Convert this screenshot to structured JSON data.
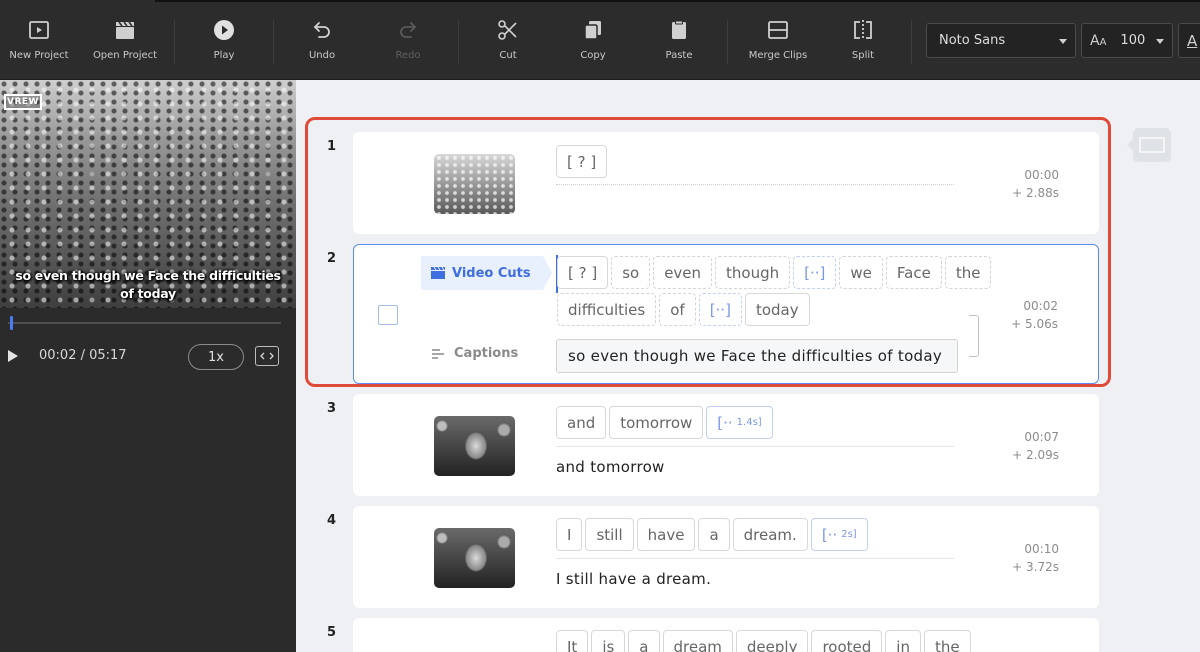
{
  "toolbar": {
    "buttons": {
      "new_project": "New Project",
      "open_project": "Open Project",
      "play": "Play",
      "undo": "Undo",
      "redo": "Redo",
      "cut": "Cut",
      "copy": "Copy",
      "paste": "Paste",
      "merge_clips": "Merge Clips",
      "split": "Split"
    },
    "font_family_value": "Noto Sans",
    "font_size_value": "100"
  },
  "preview": {
    "logo_text": "VREW",
    "subtitle": "so even though we Face the difficulties of today",
    "time": "00:02 / 05:17",
    "speed": "1x",
    "progress": 0.006
  },
  "clips": [
    {
      "number": "1",
      "tokens": [
        "[ ? ]"
      ],
      "time": "00:00",
      "duration": "+ 2.88s"
    },
    {
      "number": "2",
      "video_cuts_label": "Video Cuts",
      "captions_label": "Captions",
      "row1": [
        "[ ? ]",
        "so",
        "even",
        "though",
        "[··]",
        "we",
        "Face",
        "the"
      ],
      "row2": [
        "difficulties",
        "of",
        "[··]",
        "today"
      ],
      "caption": "so even though we Face the difficulties of today",
      "time": "00:02",
      "duration": "+ 5.06s"
    },
    {
      "number": "3",
      "tokens": [
        "and",
        "tomorrow"
      ],
      "gap": "[··",
      "gap_dur": "1.4s]",
      "caption": "and tomorrow",
      "time": "00:07",
      "duration": "+ 2.09s"
    },
    {
      "number": "4",
      "tokens": [
        "I",
        "still",
        "have",
        "a",
        "dream."
      ],
      "gap": "[··",
      "gap_dur": "2s]",
      "caption": "I still have a dream.",
      "time": "00:10",
      "duration": "+ 3.72s"
    },
    {
      "number": "5",
      "tokens": [
        "It",
        "is",
        "a",
        "dream",
        "deeply",
        "rooted",
        "in",
        "the"
      ]
    }
  ],
  "colors": {
    "accent": "#3f6ee0",
    "highlight": "#e04a38",
    "toolbar_bg": "#2c2c2c"
  }
}
